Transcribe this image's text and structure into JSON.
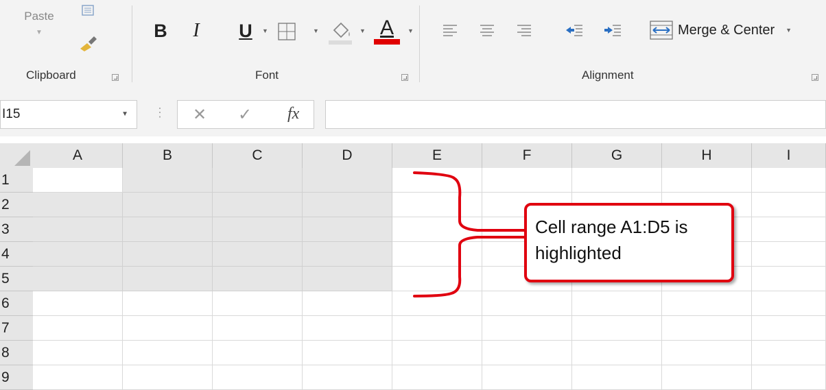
{
  "ribbon": {
    "clipboard": {
      "paste_label": "Paste",
      "group_label": "Clipboard"
    },
    "font": {
      "bold_label": "B",
      "italic_label": "I",
      "underline_label": "U",
      "font_color_label": "A",
      "group_label": "Font",
      "font_color": "#e00000"
    },
    "alignment": {
      "merge_center_label": "Merge & Center",
      "group_label": "Alignment"
    }
  },
  "formula_bar": {
    "name_box_value": "I15",
    "fx_label": "fx",
    "formula_value": ""
  },
  "sheet": {
    "columns": [
      "A",
      "B",
      "C",
      "D",
      "E",
      "F",
      "G",
      "H",
      "I"
    ],
    "rows": [
      "1",
      "2",
      "3",
      "4",
      "5",
      "6",
      "7",
      "8",
      "9"
    ],
    "selected_range": "A1:D5",
    "selection_color": "#e6e6e6"
  },
  "annotation": {
    "callout_text": "Cell range A1:D5 is highlighted",
    "accent_color": "#e0000f"
  }
}
